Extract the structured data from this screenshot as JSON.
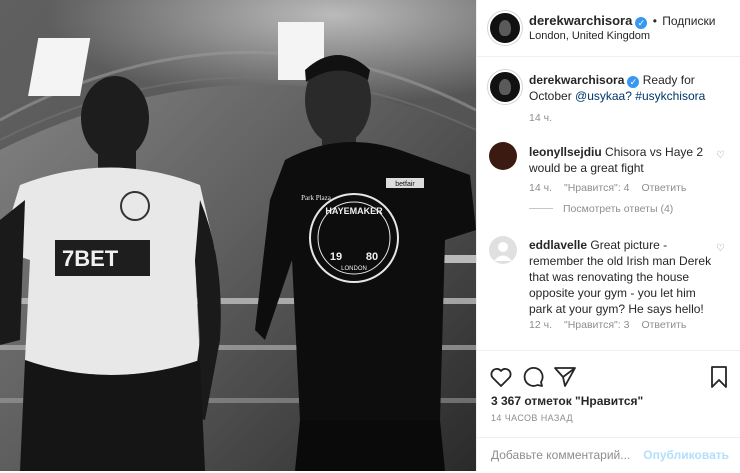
{
  "post": {
    "username": "derekwarchisora",
    "follow_label": "Подписки",
    "separator": "•",
    "location": "London, United Kingdom",
    "photo": {
      "shirt_left_brand": "7BET",
      "shirt_right_text": "HAYEMAKER",
      "shirt_right_year_left": "19",
      "shirt_right_year_right": "80",
      "shirt_right_city": "LONDON",
      "sponsor_text": "betfair",
      "park_plaza": "Park Plaza"
    }
  },
  "caption": {
    "username": "derekwarchisora",
    "text_before": "Ready for October ",
    "mention": "@usykaa?",
    "hashtag": "#usykchisora",
    "time": "14 ч."
  },
  "comments": [
    {
      "username": "leonyllsejdiu",
      "text": "Chisora vs Haye 2 would be a great fight",
      "time": "14 ч.",
      "likes": "\"Нравится\": 4",
      "reply": "Ответить",
      "view_replies": "Посмотреть ответы (4)"
    },
    {
      "username": "eddlavelle",
      "text": "Great picture - remember the old Irish man Derek that was renovating the house opposite your gym - you let him park at your gym? He says hello!",
      "time": "12 ч.",
      "likes": "\"Нравится\": 3",
      "reply": "Ответить"
    }
  ],
  "actions": {
    "likes_count": "3 367 отметок \"Нравится\"",
    "time_ago": "14 ЧАСОВ НАЗАД",
    "comment_placeholder": "Добавьте комментарий...",
    "post_label": "Опубликовать"
  },
  "colors": {
    "link": "#003569",
    "verified": "#3897f0",
    "muted": "#8e8e8e",
    "post_disabled": "#b2dffc"
  }
}
